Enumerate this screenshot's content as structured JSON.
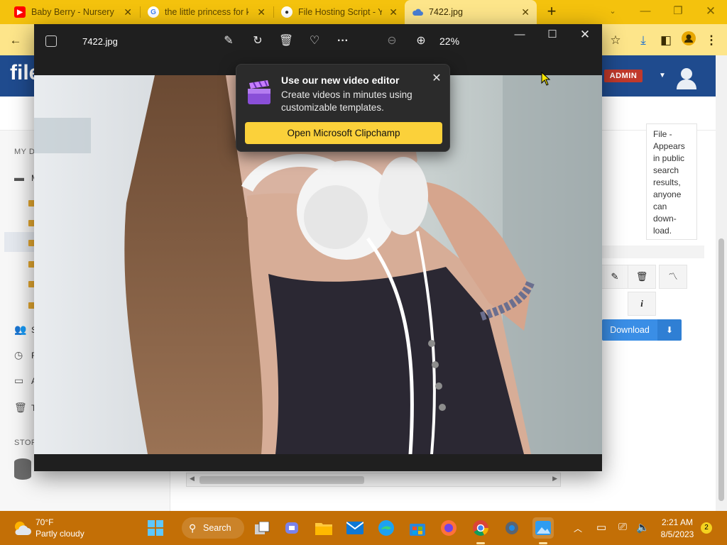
{
  "browser": {
    "tabs": [
      {
        "title": "Baby Berry - Nursery Rhymes",
        "favicon": "youtube-icon",
        "active": false
      },
      {
        "title": "the little princess for kids",
        "favicon": "google-icon",
        "active": false
      },
      {
        "title": "File Hosting Script - Yetishare",
        "favicon": "yeti-icon",
        "active": false
      },
      {
        "title": "7422.jpg",
        "favicon": "cloud-icon",
        "active": true
      }
    ],
    "colors": {
      "frame": "#f4c20d",
      "toolbar": "#fde58a"
    }
  },
  "site": {
    "logo": "file",
    "admin_badge": "ADMIN",
    "sidebar": {
      "section_mydrive": "MY D",
      "section_storage": "STOR",
      "folder_item": "M",
      "nav": [
        "S",
        "R",
        "A",
        "T"
      ]
    },
    "description_text": "File - Appears in public search results, anyone can down- load.",
    "download_label": "Download",
    "colors": {
      "header": "#1f4b8e",
      "download": "#3a8ee6",
      "admin": "#c0392b"
    }
  },
  "photos": {
    "filename": "7422.jpg",
    "zoom": "22%",
    "popup": {
      "title": "Use our new video editor",
      "body": "Create videos in minutes using customizable templates.",
      "button": "Open Microsoft Clipchamp"
    }
  },
  "taskbar": {
    "weather": {
      "temp": "70°F",
      "desc": "Partly cloudy"
    },
    "search_label": "Search",
    "time": "2:21 AM",
    "date": "8/5/2023",
    "notifications": "2"
  }
}
